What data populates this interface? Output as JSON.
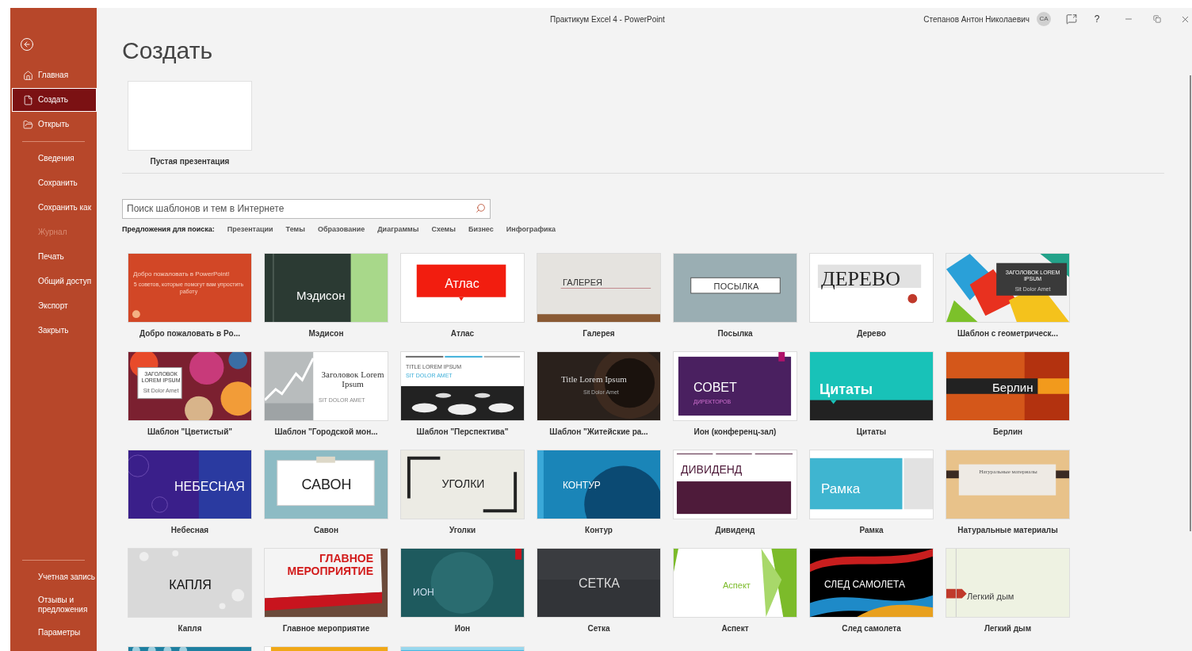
{
  "window": {
    "title": "Практикум Excel 4  -  PowerPoint",
    "user": "Степанов Антон Николаевич",
    "avatar": "СА",
    "help": "?"
  },
  "sidebar": {
    "nav": [
      {
        "kind": "home",
        "label": "Главная",
        "selected": false,
        "disabled": false
      },
      {
        "kind": "new",
        "label": "Создать",
        "selected": true,
        "disabled": false
      },
      {
        "kind": "open",
        "label": "Открыть",
        "selected": false,
        "disabled": false
      }
    ],
    "commands": [
      {
        "label": "Сведения",
        "selected": false,
        "disabled": false
      },
      {
        "label": "Сохранить",
        "selected": false,
        "disabled": false
      },
      {
        "label": "Сохранить как",
        "selected": false,
        "disabled": false
      },
      {
        "label": "Журнал",
        "selected": false,
        "disabled": true
      },
      {
        "label": "Печать",
        "selected": false,
        "disabled": false
      },
      {
        "label": "Общий доступ",
        "selected": false,
        "disabled": false
      },
      {
        "label": "Экспорт",
        "selected": false,
        "disabled": false
      },
      {
        "label": "Закрыть",
        "selected": false,
        "disabled": false
      }
    ],
    "footer": [
      {
        "label": "Учетная запись",
        "selected": false,
        "disabled": false
      },
      {
        "label": "Отзывы и предложения",
        "selected": false,
        "disabled": false
      },
      {
        "label": "Параметры",
        "selected": false,
        "disabled": false
      }
    ]
  },
  "heading": "Создать",
  "blank": {
    "label": "Пустая презентация"
  },
  "search": {
    "placeholder": "Поиск шаблонов и тем в Интернете"
  },
  "suggestions": {
    "label": "Предложения для поиска:",
    "items": [
      "Презентации",
      "Темы",
      "Образование",
      "Диаграммы",
      "Схемы",
      "Бизнес",
      "Инфографика"
    ]
  },
  "templates": [
    {
      "kind": "welcome",
      "label": "Добро пожаловать в Po...",
      "title": "Добро пожаловать в PowerPoint!",
      "subtitle": "5 советов, которые помогут вам упростить работу"
    },
    {
      "kind": "madison",
      "label": "Мэдисон",
      "title": "Мэдисон"
    },
    {
      "kind": "atlas",
      "label": "Атлас",
      "title": "Атлас"
    },
    {
      "kind": "gallery",
      "label": "Галерея",
      "title": "ГАЛЕРЕЯ"
    },
    {
      "kind": "parcel",
      "label": "Посылка",
      "title": "ПОСЫЛКА"
    },
    {
      "kind": "wood",
      "label": "Дерево",
      "title": "ДЕРЕВО"
    },
    {
      "kind": "geometric",
      "label": "Шаблон с геометрическ...",
      "title": "ЗАГОЛОВОК LOREM IPSUM",
      "subtitle": "Sit Dolor Amet"
    },
    {
      "kind": "floral",
      "label": "Шаблон \"Цветистый\"",
      "title": "ЗАГОЛОВОК LOREM IPSUM",
      "subtitle": "Sit Dolor Amet"
    },
    {
      "kind": "urban",
      "label": "Шаблон \"Городской мон...",
      "title": "Заголовок Lorem Ipsum",
      "subtitle": "SIT DOLOR AMET"
    },
    {
      "kind": "perspective",
      "label": "Шаблон \"Перспектива\"",
      "title": "TITLE LOREM IPSUM",
      "subtitle": "SIT DOLOR AMET"
    },
    {
      "kind": "coffee",
      "label": "Шаблон \"Житейские ра...",
      "title": "Title Lorem Ipsum",
      "subtitle": "Sit Dolor Amet"
    },
    {
      "kind": "board",
      "label": "Ион (конференц-зал)",
      "title": "СОВЕТ",
      "subtitle": "ДИРЕКТОРОВ"
    },
    {
      "kind": "quotes",
      "label": "Цитаты",
      "title": "Цитаты"
    },
    {
      "kind": "berlin",
      "label": "Берлин",
      "title": "Берлин"
    },
    {
      "kind": "celestial",
      "label": "Небесная",
      "title": "НЕБЕСНАЯ"
    },
    {
      "kind": "savon",
      "label": "Савон",
      "title": "САВОН"
    },
    {
      "kind": "corners",
      "label": "Уголки",
      "title": "УГОЛКИ"
    },
    {
      "kind": "contour",
      "label": "Контур",
      "title": "КОНТУР"
    },
    {
      "kind": "dividend",
      "label": "Дивиденд",
      "title": "ДИВИДЕНД"
    },
    {
      "kind": "frame",
      "label": "Рамка",
      "title": "Рамка"
    },
    {
      "kind": "natural",
      "label": "Натуральные материалы",
      "title": "Натуральные материалы"
    },
    {
      "kind": "droplet",
      "label": "Капля",
      "title": "КАПЛЯ"
    },
    {
      "kind": "event",
      "label": "Главное мероприятие",
      "title": "ГЛАВНОЕ МЕРОПРИЯТИЕ"
    },
    {
      "kind": "ion",
      "label": "Ион",
      "title": "ИОН"
    },
    {
      "kind": "mesh",
      "label": "Сетка",
      "title": "СЕТКА"
    },
    {
      "kind": "facet",
      "label": "Аспект",
      "title": "Аспект"
    },
    {
      "kind": "vapor",
      "label": "След самолета",
      "title": "СЛЕД САМОЛЕТА"
    },
    {
      "kind": "smoke",
      "label": "Легкий дым",
      "title": "Легкий дым"
    },
    {
      "kind": "teal"
    },
    {
      "kind": "orange"
    },
    {
      "kind": "sky"
    }
  ]
}
